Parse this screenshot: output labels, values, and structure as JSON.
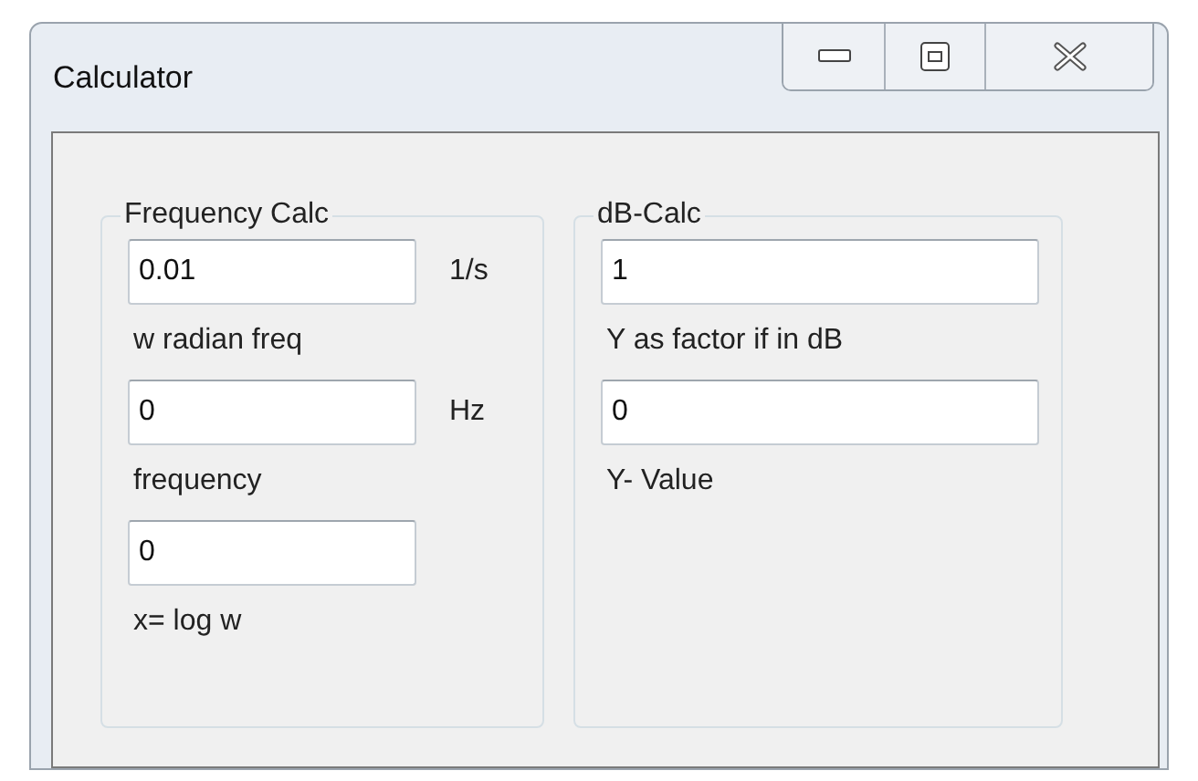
{
  "window": {
    "title": "Calculator"
  },
  "groups": [
    {
      "title": "Frequency Calc",
      "rows": [
        {
          "value": "0.01",
          "unit": "1/s",
          "caption": "w radian freq"
        },
        {
          "value": "0",
          "unit": "Hz",
          "caption": "frequency"
        },
        {
          "value": "0",
          "caption": "x= log w"
        }
      ]
    },
    {
      "title": "dB-Calc",
      "rows": [
        {
          "value": "1",
          "caption": "Y as factor if in dB"
        },
        {
          "value": "0",
          "caption": "Y- Value"
        }
      ]
    }
  ]
}
